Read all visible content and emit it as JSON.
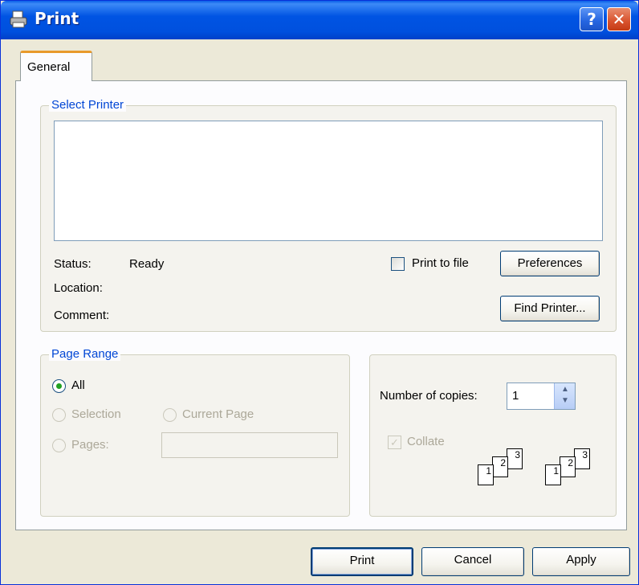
{
  "window": {
    "title": "Print",
    "help_glyph": "?",
    "close_glyph": "✕"
  },
  "tabs": [
    {
      "label": "General"
    }
  ],
  "select_printer": {
    "title": "Select Printer",
    "status_label": "Status:",
    "status_value": "Ready",
    "location_label": "Location:",
    "comment_label": "Comment:",
    "print_to_file_label": "Print to file",
    "preferences_label": "Preferences",
    "find_printer_label": "Find Printer..."
  },
  "page_range": {
    "title": "Page Range",
    "all_label": "All",
    "selection_label": "Selection",
    "current_page_label": "Current Page",
    "pages_label": "Pages:",
    "pages_value": ""
  },
  "copies": {
    "number_label": "Number of copies:",
    "number_value": "1",
    "collate_label": "Collate",
    "collate_checked": true
  },
  "buttons": {
    "print": "Print",
    "cancel": "Cancel",
    "apply": "Apply"
  },
  "colors": {
    "titlebar": "#0054e3",
    "group_title": "#0046d5",
    "face": "#ece9d8"
  }
}
